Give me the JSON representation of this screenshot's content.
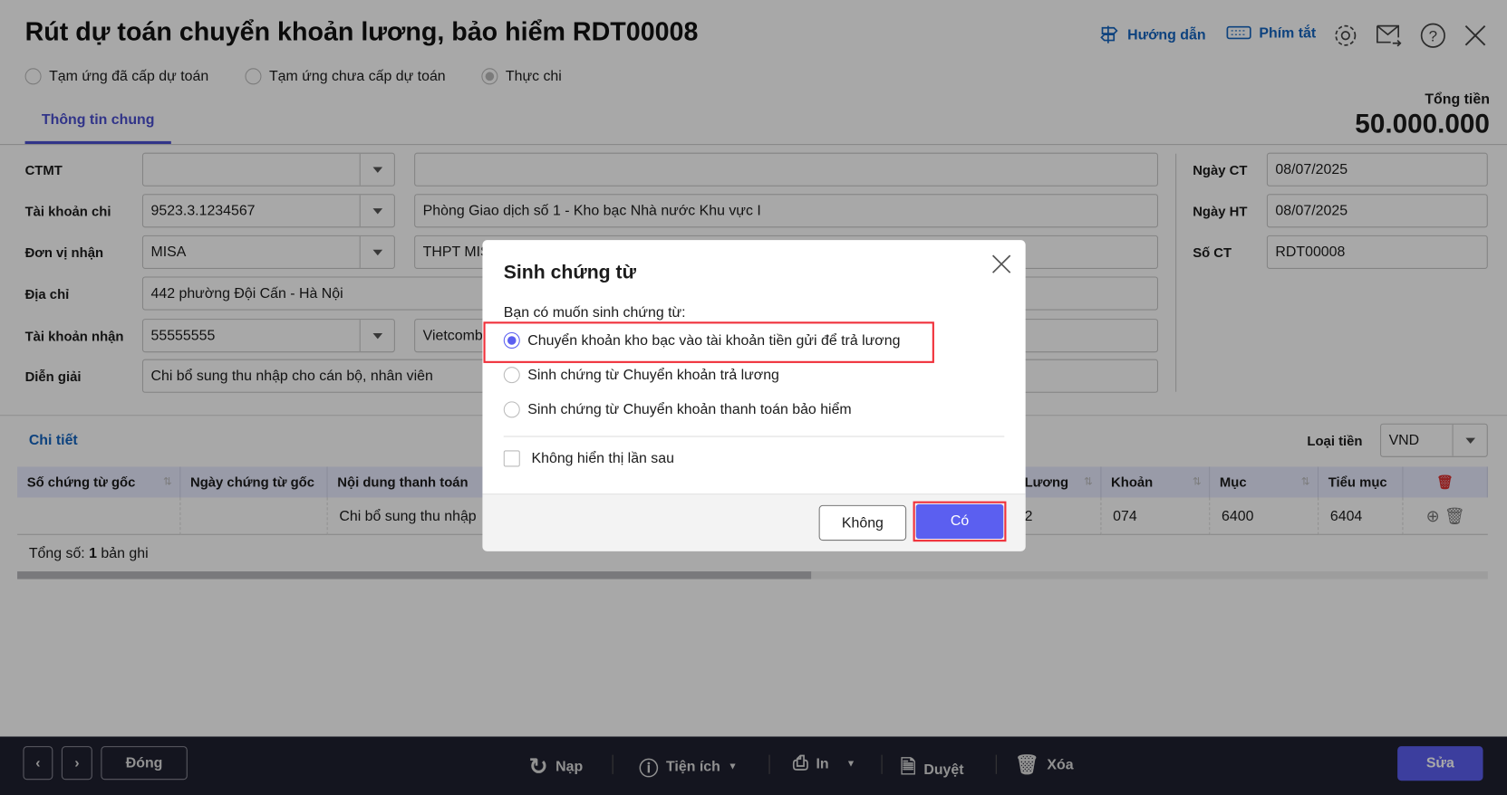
{
  "header": {
    "title": "Rút dự toán chuyển khoản lương, bảo hiểm RDT00008",
    "guide": "Hướng dẫn",
    "shortcuts": "Phím tắt",
    "total_label": "Tổng tiền",
    "total_value": "50.000.000"
  },
  "modes": [
    {
      "label": "Tạm ứng đã cấp dự toán",
      "selected": false
    },
    {
      "label": "Tạm ứng chưa cấp dự toán",
      "selected": false
    },
    {
      "label": "Thực chi",
      "selected": true
    }
  ],
  "tabs": [
    {
      "label": "Thông tin chung",
      "active": true
    }
  ],
  "form": {
    "ctmt": {
      "label": "CTMT",
      "value": "",
      "name": ""
    },
    "tk_chi": {
      "label": "Tài khoản chi",
      "value": "9523.3.1234567",
      "name": "Phòng Giao dịch số 1 - Kho bạc Nhà nước Khu vực I"
    },
    "don_vi": {
      "label": "Đơn vị nhận",
      "value": "MISA",
      "name": "THPT MISA"
    },
    "dia_chi": {
      "label": "Địa chỉ",
      "value": "442 phường Đội Cấn - Hà Nội"
    },
    "tk_nhan": {
      "label": "Tài khoản nhận",
      "value": "55555555",
      "name": "Vietcombank"
    },
    "dien_giai": {
      "label": "Diễn giải",
      "value": "Chi bổ sung thu nhập cho cán bộ, nhân viên"
    },
    "ngay_ct": {
      "label": "Ngày CT",
      "value": "08/07/2025"
    },
    "ngay_ht": {
      "label": "Ngày HT",
      "value": "08/07/2025"
    },
    "so_ct": {
      "label": "Số CT",
      "value": "RDT00008"
    }
  },
  "detail": {
    "title": "Chi tiết",
    "currency_label": "Loại tiền",
    "currency": "VND",
    "columns": [
      "Số chứng từ gốc",
      "Ngày chứng từ gốc",
      "Nội dung thanh toán",
      "Lương",
      "Khoản",
      "Mục",
      "Tiểu mục"
    ],
    "rows": [
      [
        "",
        "",
        "Chi bổ sung thu nhập",
        "2",
        "074",
        "6400",
        "6404"
      ]
    ],
    "total_prefix": "Tổng số: ",
    "total_count": "1",
    "total_suffix": " bản ghi",
    "scroll_fraction": 0.54
  },
  "toolbar": {
    "close": "Đóng",
    "reload": "Nạp",
    "utility": "Tiện ích",
    "print": "In",
    "approve": "Duyệt",
    "delete": "Xóa",
    "edit": "Sửa"
  },
  "dialog": {
    "title": "Sinh chứng từ",
    "question": "Bạn có muốn sinh chứng từ:",
    "options": [
      {
        "label": "Chuyển khoản kho bạc vào tài khoản tiền gửi để trả lương",
        "selected": true
      },
      {
        "label": "Sinh chứng từ Chuyển khoản trả lương",
        "selected": false
      },
      {
        "label": "Sinh chứng từ Chuyển khoản thanh toán bảo hiểm",
        "selected": false
      }
    ],
    "dont_show": "Không hiển thị lần sau",
    "no": "Không",
    "yes": "Có"
  },
  "colors": {
    "accent": "#5b5ff0",
    "link": "#1565c0",
    "highlight": "#f0303a",
    "bottom_bar": "#1f2030"
  }
}
